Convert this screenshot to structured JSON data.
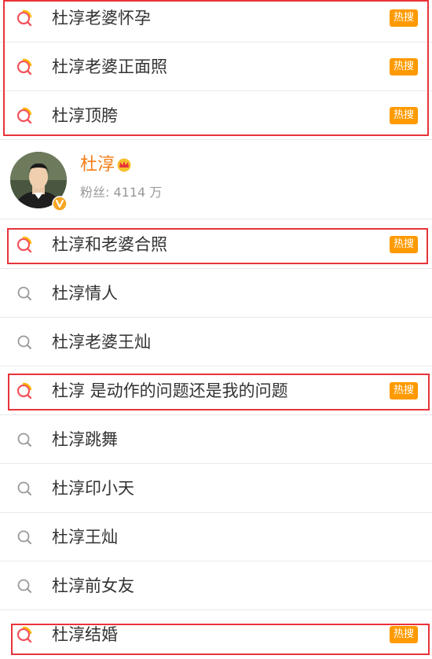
{
  "hot_label": "热搜",
  "top_rows": [
    {
      "text": "杜淳老婆怀孕",
      "hot": true
    },
    {
      "text": "杜淳老婆正面照",
      "hot": true
    },
    {
      "text": "杜淳顶胯",
      "hot": true
    }
  ],
  "user": {
    "name": "杜淳",
    "fans_label": "粉丝:",
    "fans_count": "4114",
    "fans_unit": "万"
  },
  "bottom_rows": [
    {
      "text": "杜淳和老婆合照",
      "hot": true
    },
    {
      "text": "杜淳情人",
      "hot": false
    },
    {
      "text": "杜淳老婆王灿",
      "hot": false
    },
    {
      "text": "杜淳 是动作的问题还是我的问题",
      "hot": true
    },
    {
      "text": "杜淳跳舞",
      "hot": false
    },
    {
      "text": "杜淳印小天",
      "hot": false
    },
    {
      "text": "杜淳王灿",
      "hot": false
    },
    {
      "text": "杜淳前女友",
      "hot": false
    },
    {
      "text": "杜淳结婚",
      "hot": true
    }
  ],
  "colors": {
    "accent_orange": "#ff9a00",
    "username_orange": "#f57c13",
    "highlight_red": "#e8333a"
  }
}
